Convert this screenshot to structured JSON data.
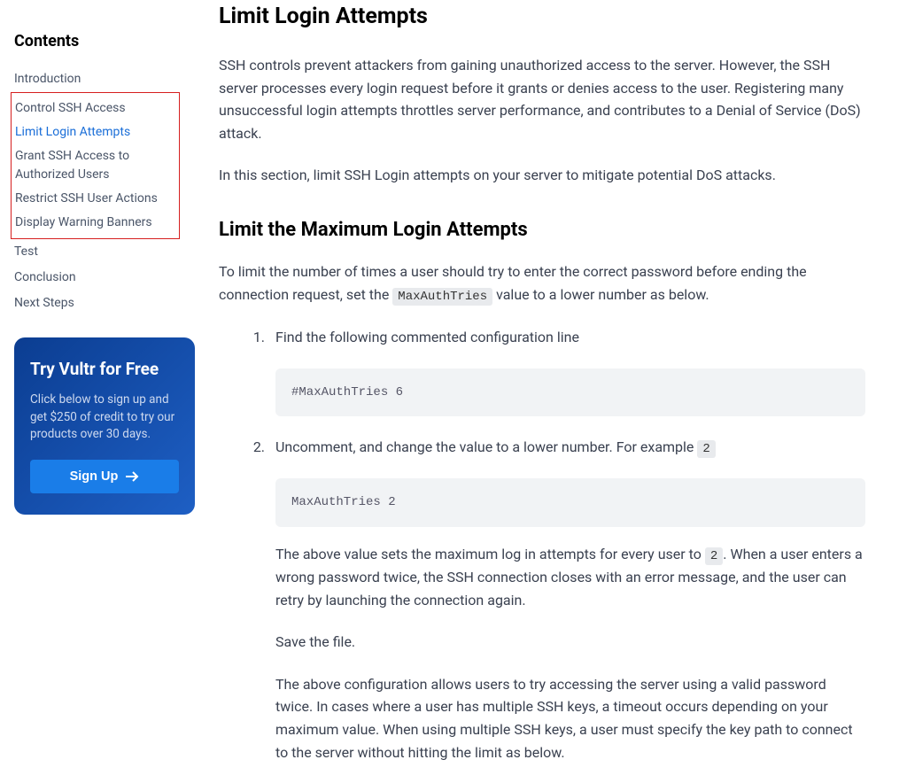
{
  "sidebar": {
    "title": "Contents",
    "items": [
      {
        "label": "Introduction",
        "active": false,
        "highlighted": false
      },
      {
        "label": "Control SSH Access",
        "active": false,
        "highlighted": true
      },
      {
        "label": "Limit Login Attempts",
        "active": true,
        "highlighted": true
      },
      {
        "label": "Grant SSH Access to Authorized Users",
        "active": false,
        "highlighted": true
      },
      {
        "label": "Restrict SSH User Actions",
        "active": false,
        "highlighted": true
      },
      {
        "label": "Display Warning Banners",
        "active": false,
        "highlighted": true
      },
      {
        "label": "Test",
        "active": false,
        "highlighted": false
      },
      {
        "label": "Conclusion",
        "active": false,
        "highlighted": false
      },
      {
        "label": "Next Steps",
        "active": false,
        "highlighted": false
      }
    ]
  },
  "promo": {
    "title": "Try Vultr for Free",
    "text": "Click below to sign up and get $250 of credit to try our products over 30 days.",
    "button": "Sign Up"
  },
  "main": {
    "h2": "Limit Login Attempts",
    "p1": "SSH controls prevent attackers from gaining unauthorized access to the server. However, the SSH server processes every login request before it grants or denies access to the user. Registering many unsuccessful login attempts throttles server performance, and contributes to a Denial of Service (DoS) attack.",
    "p2": "In this section, limit SSH Login attempts on your server to mitigate potential DoS attacks.",
    "h3": "Limit the Maximum Login Attempts",
    "p3_a": "To limit the number of times a user should try to enter the correct password before ending the connection request, set the ",
    "p3_code": "MaxAuthTries",
    "p3_b": " value to a lower number as below.",
    "li1": "Find the following commented configuration line",
    "code1": "#MaxAuthTries 6",
    "li2_a": "Uncomment, and change the value to a lower number. For example ",
    "li2_code": "2",
    "code2": "MaxAuthTries 2",
    "li2_p2_a": "The above value sets the maximum log in attempts for every user to ",
    "li2_p2_code": "2",
    "li2_p2_b": ". When a user enters a wrong password twice, the SSH connection closes with an error message, and the user can retry by launching the connection again.",
    "li2_p3": "Save the file.",
    "li2_p4": "The above configuration allows users to try accessing the server using a valid password twice. In cases where a user has multiple SSH keys, a timeout occurs depending on your maximum value. When using multiple SSH keys, a user must specify the key path to connect to the server without hitting the limit as below."
  }
}
